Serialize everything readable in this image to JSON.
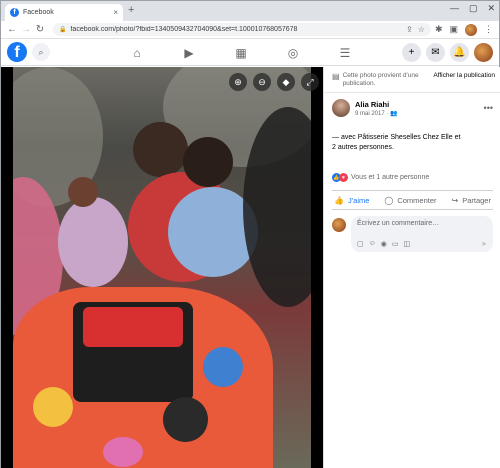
{
  "tab": {
    "title": "Facebook",
    "close": "×",
    "new": "+"
  },
  "window": {
    "minimize": "—",
    "maximize": "▢",
    "close": "✕"
  },
  "address": {
    "url": "facebook.com/photo/?fbid=134050943270409​0&set=t.100010768057678"
  },
  "fb_logo": "f",
  "photo_controls": [
    "zoom-in",
    "zoom-out",
    "tag",
    "fullscreen"
  ],
  "side": {
    "notice_text": "Cette photo provient d'une publication.",
    "notice_link": "Afficher la publication",
    "author_name": "Alia Riahi",
    "author_date": "9 mai 2017 · ",
    "caption_prefix": "— avec ",
    "caption_tag": "Pâtisserie Sheselles Chez Elle",
    "caption_mid": " et",
    "caption_more": "2 autres personnes",
    "caption_end": ".",
    "reactions_text": "Vous et 1 autre personne",
    "like_label": "J'aime",
    "comment_label": "Commenter",
    "share_label": "Partager",
    "comment_placeholder": "Écrivez un commentaire…"
  },
  "colors": {
    "fb_blue": "#1877f2",
    "love_red": "#f33e58"
  }
}
